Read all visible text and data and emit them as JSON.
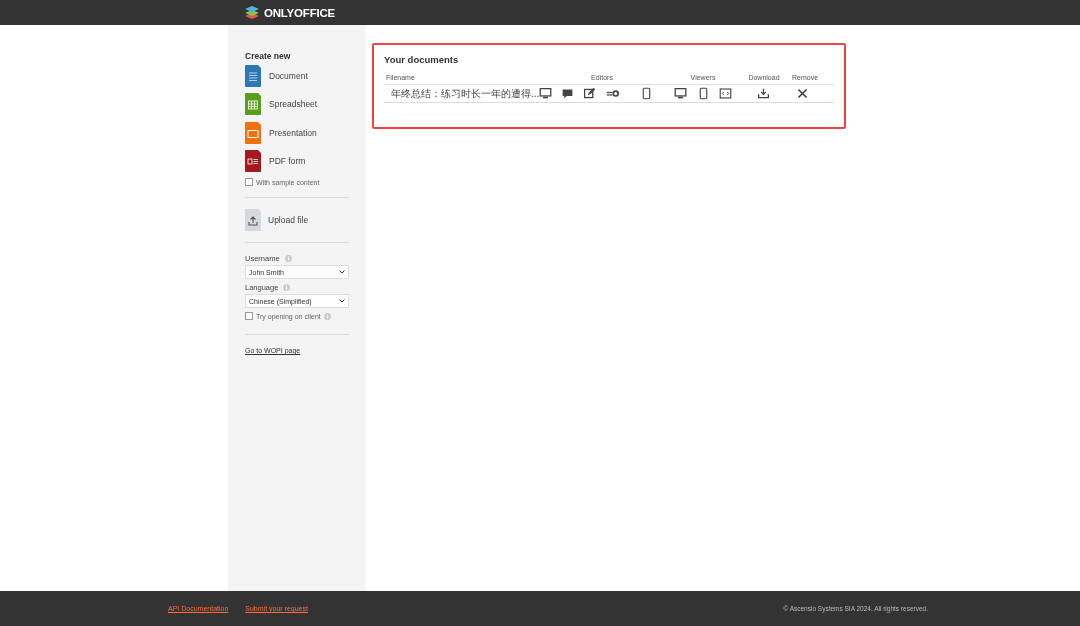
{
  "header": {
    "logo": "ONLYOFFICE"
  },
  "sidebar": {
    "create_title": "Create new",
    "create_items": [
      {
        "kind": "document",
        "label": "Document"
      },
      {
        "kind": "spreadsheet",
        "label": "Spreadsheet"
      },
      {
        "kind": "presentation",
        "label": "Presentation"
      },
      {
        "kind": "pdf",
        "label": "PDF form"
      }
    ],
    "sample_content": {
      "label": "With sample content",
      "checked": false
    },
    "upload": {
      "label": "Upload file"
    },
    "username": {
      "label": "Username",
      "value": "John Smith"
    },
    "language": {
      "label": "Language",
      "value": "Chinese (Simplified)"
    },
    "try_client": {
      "label": "Try opening on client",
      "checked": false
    },
    "wopi_link": "Go to WOPI page"
  },
  "documents": {
    "title": "Your documents",
    "columns": [
      "Filename",
      "Editors",
      "Viewers",
      "Download",
      "Remove"
    ],
    "rows": [
      {
        "filename": "年终总结：练习时长一年的遭得...",
        "editors": [
          {
            "kind": "desktop"
          },
          {
            "kind": "comment"
          },
          {
            "kind": "review"
          },
          {
            "kind": "fill"
          },
          {
            "kind": "mobile"
          }
        ],
        "viewers": [
          {
            "kind": "desktop"
          },
          {
            "kind": "mobile"
          },
          {
            "kind": "embed"
          }
        ],
        "download": {
          "kind": "download"
        },
        "remove": {
          "kind": "remove"
        }
      }
    ]
  },
  "footer": {
    "links": [
      "API Documentation",
      "Submit your request"
    ],
    "copyright": "© Ascensio Systems SIA 2024. All rights reserved."
  }
}
